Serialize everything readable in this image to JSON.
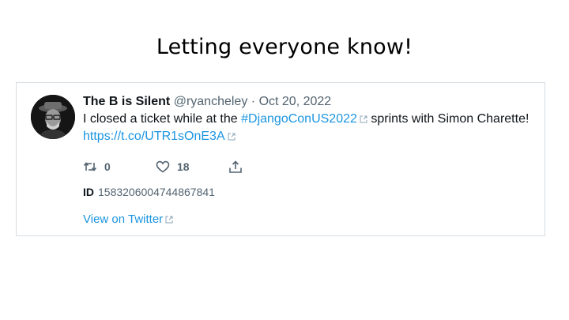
{
  "slide": {
    "title": "Letting everyone know!"
  },
  "tweet": {
    "author_name": "The B is Silent",
    "handle": "@ryancheley",
    "separator": "·",
    "date": "Oct 20, 2022",
    "text_part1": "I closed a ticket while at the ",
    "hashtag": "#DjangoConUS2022",
    "text_part2": " sprints with Simon Charette! ",
    "link": "https://t.co/UTR1sOnE3A",
    "retweet_count": "0",
    "like_count": "18",
    "id_label": "ID",
    "id_value": "1583206004744867841",
    "view_label": "View on Twitter"
  },
  "icons": {
    "retweet": "retweet-icon",
    "like": "heart-icon",
    "share": "share-icon",
    "external": "external-link-icon"
  },
  "colors": {
    "link": "#1b95e0",
    "muted": "#536471",
    "text": "#0f1419",
    "border": "#d7dde2"
  }
}
